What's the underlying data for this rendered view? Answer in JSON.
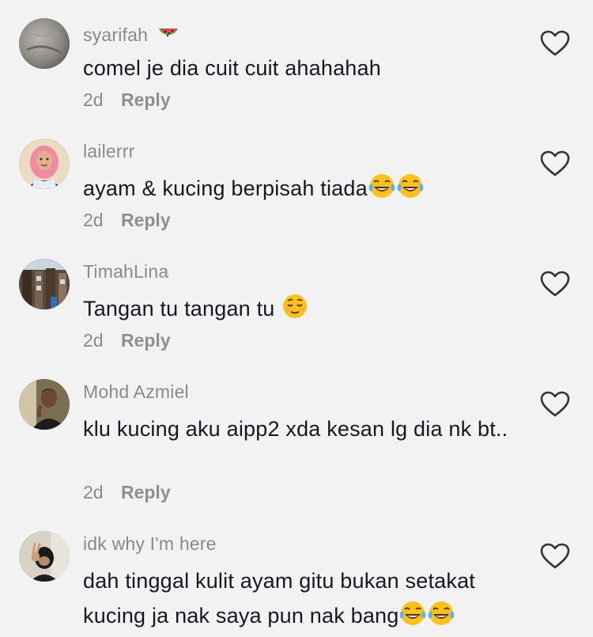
{
  "comments": [
    {
      "username": "syarifah",
      "username_emoji": "watermelon",
      "text": "comel je dia cuit cuit ahahahah",
      "trailing_emoji": [],
      "time": "2d",
      "reply_label": "Reply",
      "avatar": "blurred-grey-photo"
    },
    {
      "username": "lailerrr",
      "text": "ayam & kucing berpisah tiada",
      "trailing_emoji": [
        "face-with-tears-of-joy",
        "face-with-tears-of-joy"
      ],
      "time": "2d",
      "reply_label": "Reply",
      "avatar": "woman-pink-hijab-photo"
    },
    {
      "username": "TimahLina",
      "text": "Tangan tu tangan tu ",
      "trailing_emoji": [
        "relieved-face"
      ],
      "time": "2d",
      "reply_label": "Reply",
      "avatar": "building-photo"
    },
    {
      "username": "Mohd Azmiel",
      "text": "klu kucing aku aipp2 xda kesan lg dia nk bt..",
      "trailing_emoji": [],
      "time": "2d",
      "reply_label": "Reply",
      "avatar": "man-dark-photo"
    },
    {
      "username": "idk why I'm here",
      "text": "dah tinggal kulit ayam gitu bukan setakat kucing ja nak saya pun nak bang",
      "trailing_emoji": [
        "face-with-tears-of-joy",
        "face-with-tears-of-joy"
      ],
      "avatar": "person-peace-sign-photo"
    }
  ],
  "icons": {
    "like": "heart-outline-icon"
  },
  "colors": {
    "background": "#f2f2f2",
    "text": "#161823",
    "secondary": "#8a8a8a"
  }
}
